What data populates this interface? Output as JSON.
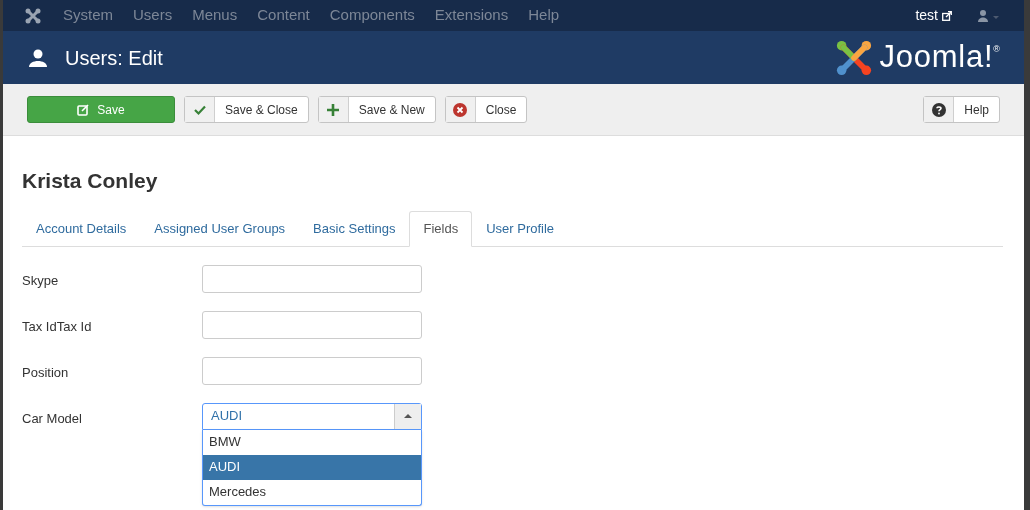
{
  "top_menu": {
    "items": [
      "System",
      "Users",
      "Menus",
      "Content",
      "Components",
      "Extensions",
      "Help"
    ],
    "site_link": "test"
  },
  "header": {
    "title": "Users: Edit",
    "logo_text": "Joomla!",
    "logo_mark": "®"
  },
  "toolbar": {
    "buttons": [
      {
        "label": "Save",
        "kind": "save"
      },
      {
        "label": "Save & Close",
        "kind": "save-close"
      },
      {
        "label": "Save & New",
        "kind": "save-new"
      },
      {
        "label": "Close",
        "kind": "close"
      }
    ],
    "help": {
      "label": "Help",
      "kind": "help"
    }
  },
  "record_title": "Krista Conley",
  "tabs": [
    {
      "label": "Account Details",
      "selected": false
    },
    {
      "label": "Assigned User Groups",
      "selected": false
    },
    {
      "label": "Basic Settings",
      "selected": false
    },
    {
      "label": "Fields",
      "selected": true
    },
    {
      "label": "User Profile",
      "selected": false
    }
  ],
  "fields": [
    {
      "label": "Skype",
      "kind": "text"
    },
    {
      "label": "Tax IdTax Id",
      "kind": "text"
    },
    {
      "label": "Position",
      "kind": "text"
    },
    {
      "label": "Car Model",
      "kind": "select",
      "value": "AUDI",
      "expanded": true,
      "options": [
        {
          "label": "BMW",
          "selected": false
        },
        {
          "label": "AUDI",
          "selected": true
        },
        {
          "label": "Mercedes",
          "selected": false
        }
      ]
    }
  ]
}
